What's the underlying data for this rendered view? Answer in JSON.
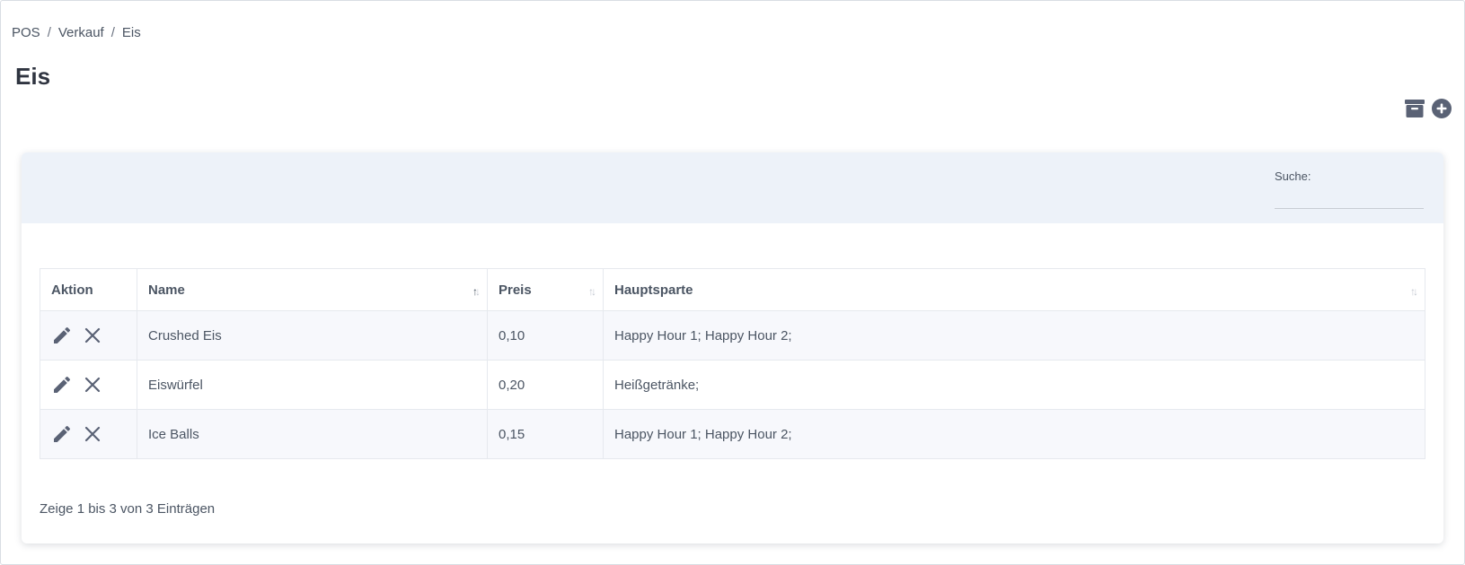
{
  "breadcrumb": [
    "POS",
    "Verkauf",
    "Eis"
  ],
  "page_title": "Eis",
  "search": {
    "label": "Suche:",
    "value": "",
    "placeholder": ""
  },
  "table": {
    "headers": [
      "Aktion",
      "Name",
      "Preis",
      "Hauptsparte"
    ],
    "rows": [
      {
        "name": "Crushed Eis",
        "price": "0,10",
        "category": "Happy Hour 1; Happy Hour 2;"
      },
      {
        "name": "Eiswürfel",
        "price": "0,20",
        "category": "Heißgetränke;"
      },
      {
        "name": "Ice Balls",
        "price": "0,15",
        "category": "Happy Hour 1; Happy Hour 2;"
      }
    ]
  },
  "info_text": "Zeige 1 bis 3 von 3 Einträgen",
  "icons": {
    "archive": "archive-icon",
    "add": "plus-circle-icon",
    "edit": "pencil-icon",
    "delete": "close-icon"
  },
  "colors": {
    "icon": "#5a6275",
    "card_header": "#edf2f9",
    "row_stripe": "#f7f8fc",
    "title": "#2f3440"
  }
}
